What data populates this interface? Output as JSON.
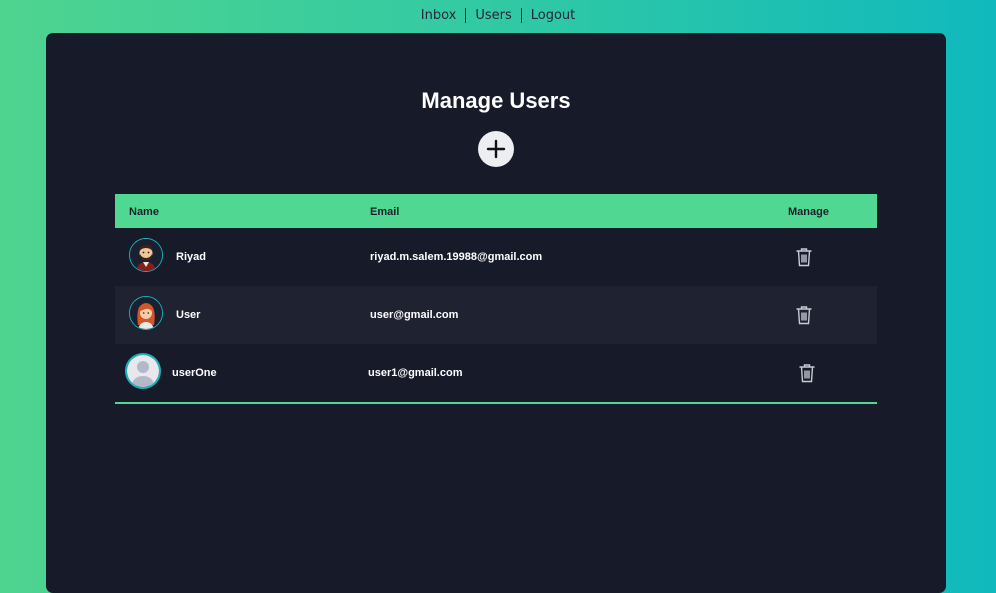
{
  "nav": {
    "items": [
      "Inbox",
      "Users",
      "Logout"
    ]
  },
  "page": {
    "title": "Manage Users",
    "add_icon": "plus-icon"
  },
  "table": {
    "columns": [
      "Name",
      "Email",
      "Manage"
    ],
    "rows": [
      {
        "name": "Riyad",
        "email": "riyad.m.salem.19988@gmail.com",
        "avatar": "bearded-man-avatar",
        "action_icon": "trash-icon"
      },
      {
        "name": "User",
        "email": "user@gmail.com",
        "avatar": "red-haired-woman-avatar",
        "action_icon": "trash-icon"
      },
      {
        "name": "userOne",
        "email": "user1@gmail.com",
        "avatar": "default-user-avatar",
        "action_icon": "trash-icon"
      }
    ]
  },
  "colors": {
    "accent": "#50d893",
    "panel": "#171b29",
    "row_alt": "#1f2230",
    "avatar_ring": "#1ab3bb"
  }
}
